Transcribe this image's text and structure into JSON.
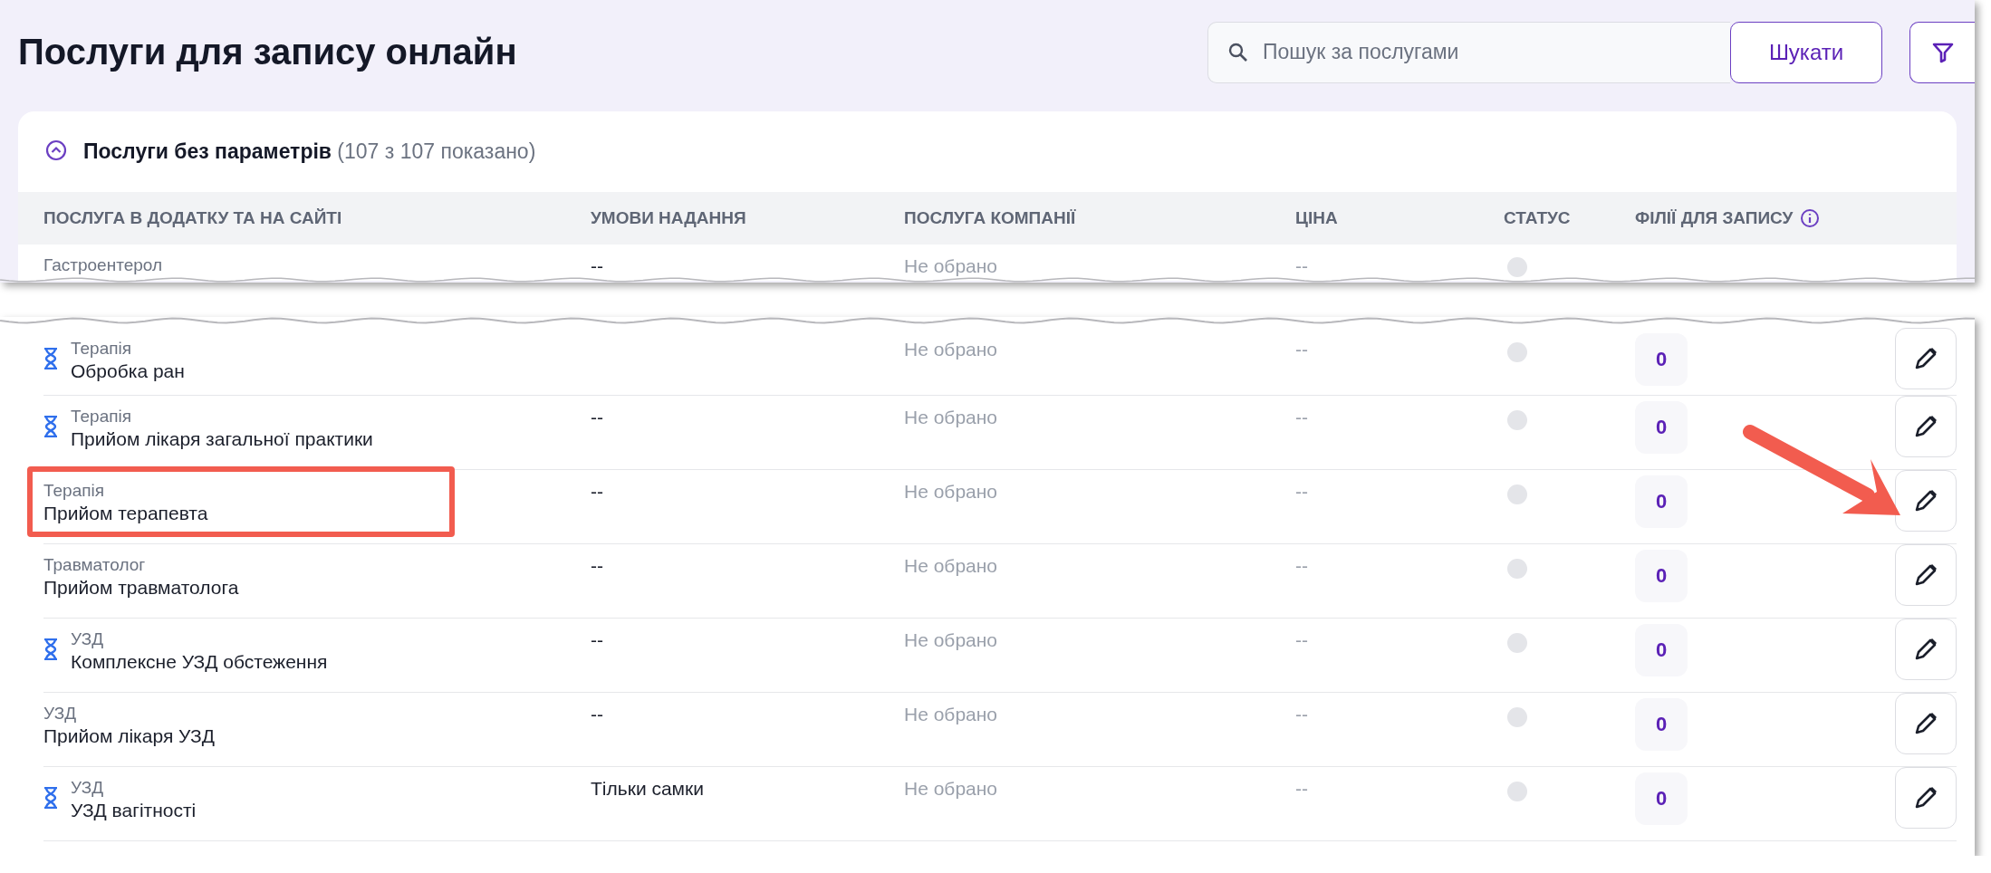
{
  "title": "Послуги для запису онлайн",
  "search": {
    "placeholder": "Пошук за послугами",
    "button": "Шукати"
  },
  "section": {
    "title": "Послуги без параметрів",
    "count": "(107 з 107 показано)",
    "expanded": true
  },
  "columns": [
    "ПОСЛУГА В ДОДАТКУ ТА НА САЙТІ",
    "УМОВИ НАДАННЯ",
    "ПОСЛУГА КОМПАНІЇ",
    "ЦІНА",
    "СТАТУС",
    "ФІЛІЇ ДЛЯ ЗАПИСУ"
  ],
  "top_rows": [
    {
      "kind": "cut",
      "category": "Гастроентерол",
      "timed": false,
      "conditions": "--",
      "company_service": "Не обрано",
      "price": "--",
      "active": false,
      "highlighted": false,
      "pointed": false
    }
  ],
  "rows": [
    {
      "category": "Терапія",
      "name": "Обробка ран",
      "timed": true,
      "company_service": "Не обрано",
      "price": "--",
      "active": false,
      "branches": "0",
      "highlighted": false,
      "pointed": false
    },
    {
      "category": "Терапія",
      "name": "Прийом лікаря загальної практики",
      "timed": true,
      "conditions": "--",
      "company_service": "Не обрано",
      "price": "--",
      "active": false,
      "branches": "0",
      "highlighted": false,
      "pointed": false
    },
    {
      "category": "Терапія",
      "name": "Прийом терапевта",
      "timed": false,
      "conditions": "--",
      "company_service": "Не обрано",
      "price": "--",
      "active": false,
      "branches": "0",
      "highlighted": true,
      "pointed": true
    },
    {
      "category": "Травматолог",
      "name": "Прийом травматолога",
      "timed": false,
      "conditions": "--",
      "company_service": "Не обрано",
      "price": "--",
      "active": false,
      "branches": "0",
      "highlighted": false,
      "pointed": false
    },
    {
      "category": "УЗД",
      "name": "Комплексне УЗД обстеження",
      "timed": true,
      "conditions": "--",
      "company_service": "Не обрано",
      "price": "--",
      "active": false,
      "branches": "0",
      "highlighted": false,
      "pointed": false
    },
    {
      "category": "УЗД",
      "name": "Прийом лікаря УЗД",
      "timed": false,
      "conditions": "--",
      "company_service": "Не обрано",
      "price": "--",
      "active": false,
      "branches": "0",
      "highlighted": false,
      "pointed": false
    },
    {
      "category": "УЗД",
      "name": "УЗД вагітності",
      "timed": true,
      "conditions": "Тільки самки",
      "company_service": "Не обрано",
      "price": "--",
      "active": false,
      "branches": "0",
      "highlighted": false,
      "pointed": false
    }
  ]
}
